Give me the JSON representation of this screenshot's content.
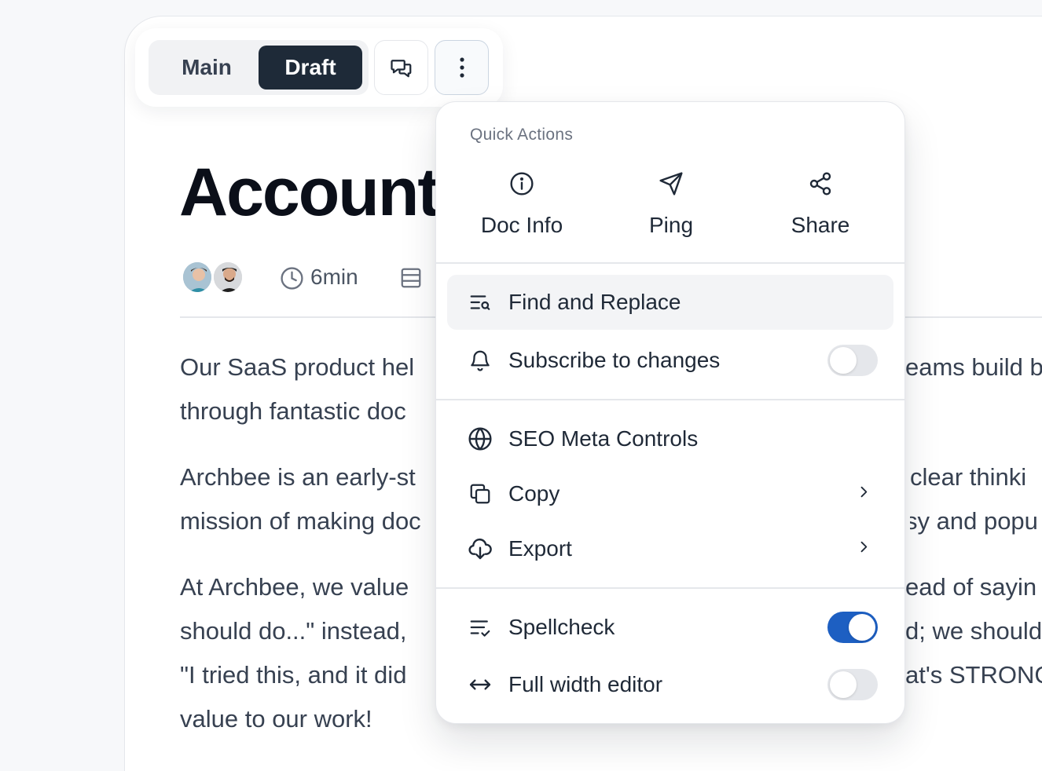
{
  "toolbar": {
    "tab_main": "Main",
    "tab_draft": "Draft",
    "active_tab": "Draft"
  },
  "document": {
    "title": "Account",
    "read_time": "6min",
    "paragraphs": [
      [
        "Our SaaS product hel",
        "eams build b"
      ],
      [
        "through fantastic doc",
        ""
      ],
      [
        "Archbee is an early-st",
        "clear thinki"
      ],
      [
        "mission of making doc",
        "sy and popu"
      ],
      [
        "At Archbee, we value",
        "ead of sayin"
      ],
      [
        "should do...\" instead, ",
        "d; we should"
      ],
      [
        "\"I tried this, and it did",
        "at's STRONG"
      ],
      [
        "value to our work!",
        ""
      ]
    ]
  },
  "menu": {
    "heading": "Quick Actions",
    "quick_actions": [
      {
        "label": "Doc Info",
        "icon": "info-icon"
      },
      {
        "label": "Ping",
        "icon": "send-icon"
      },
      {
        "label": "Share",
        "icon": "share-icon"
      }
    ],
    "items": {
      "find_replace": "Find and Replace",
      "subscribe": "Subscribe to changes",
      "seo": "SEO Meta Controls",
      "copy": "Copy",
      "export": "Export",
      "spellcheck": "Spellcheck",
      "full_width": "Full width editor"
    },
    "toggles": {
      "subscribe": false,
      "spellcheck": true,
      "full_width": false
    }
  },
  "colors": {
    "accent": "#1d5fc2",
    "dark_button": "#1e2a38",
    "hover_bg": "#f3f4f6"
  }
}
